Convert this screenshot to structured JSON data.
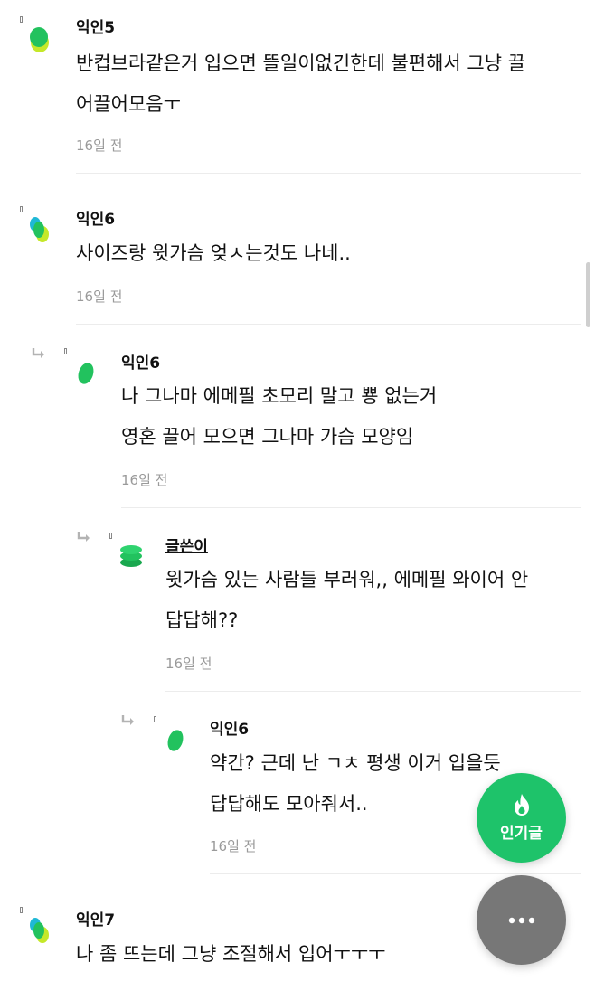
{
  "comments": [
    {
      "author": "익인5",
      "lines": [
        "반컵브라같은거 입으면 뜰일이없긴한데 불편해서 그냥 끌",
        "어끌어모음ㅜ"
      ],
      "time": "16일 전"
    },
    {
      "author": "익인6",
      "lines": [
        "사이즈랑 윗가슴 엊ㅅ는것도 나네.."
      ],
      "time": "16일 전"
    },
    {
      "author": "익인6",
      "lines": [
        "나 그나마 에메필 초모리 말고 뿅 없는거",
        "영혼 끌어 모으면 그나마 가슴 모양임"
      ],
      "time": "16일 전"
    },
    {
      "author": "글쓴이",
      "lines": [
        "윗가슴 있는 사람들 부러워,, 에메필 와이어 안",
        "답답해??"
      ],
      "time": "16일 전"
    },
    {
      "author": "익인6",
      "lines": [
        "약간? 근데 난 ㄱㅊ 평생 이거 입을듯",
        "답답해도 모아줘서.."
      ],
      "time": "16일 전"
    },
    {
      "author": "익인7",
      "lines": [
        "나 좀 뜨는데 그냥 조절해서 입어ㅜㅜㅜ"
      ],
      "time": ""
    }
  ],
  "fab": {
    "hot_label": "인기글",
    "more_label": "더보기"
  },
  "colors": {
    "green": "#1ec36a",
    "avatar_green": "#22c25e",
    "avatar_lime": "#c5e829",
    "avatar_cyan": "#1fb8d6",
    "gray_fab": "#777777"
  }
}
